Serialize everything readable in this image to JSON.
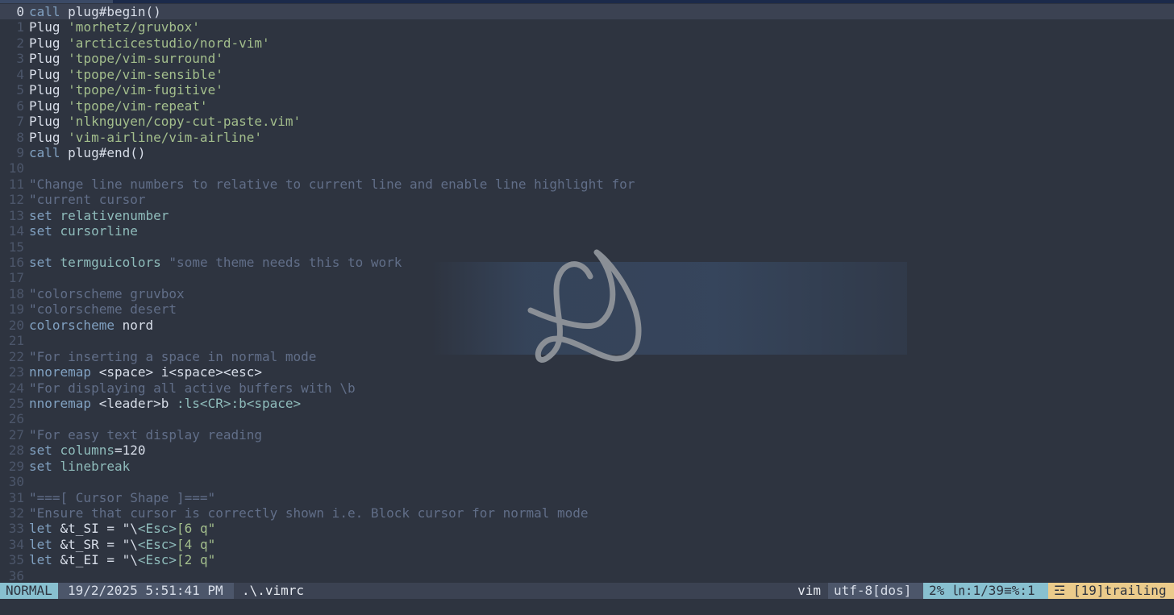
{
  "editor": {
    "lines": [
      {
        "n": "0",
        "current": true,
        "tokens": [
          [
            "kw",
            "call"
          ],
          [
            "plain",
            " plug#begin()"
          ]
        ]
      },
      {
        "n": "1",
        "tokens": [
          [
            "plain",
            "Plug "
          ],
          [
            "str",
            "'morhetz/gruvbox'"
          ]
        ]
      },
      {
        "n": "2",
        "tokens": [
          [
            "plain",
            "Plug "
          ],
          [
            "str",
            "'arcticicestudio/nord-vim'"
          ]
        ]
      },
      {
        "n": "3",
        "tokens": [
          [
            "plain",
            "Plug "
          ],
          [
            "str",
            "'tpope/vim-surround'"
          ]
        ]
      },
      {
        "n": "4",
        "tokens": [
          [
            "plain",
            "Plug "
          ],
          [
            "str",
            "'tpope/vim-sensible'"
          ]
        ]
      },
      {
        "n": "5",
        "tokens": [
          [
            "plain",
            "Plug "
          ],
          [
            "str",
            "'tpope/vim-fugitive'"
          ]
        ]
      },
      {
        "n": "6",
        "tokens": [
          [
            "plain",
            "Plug "
          ],
          [
            "str",
            "'tpope/vim-repeat'"
          ]
        ]
      },
      {
        "n": "7",
        "tokens": [
          [
            "plain",
            "Plug "
          ],
          [
            "str",
            "'nlknguyen/copy-cut-paste.vim'"
          ]
        ]
      },
      {
        "n": "8",
        "tokens": [
          [
            "plain",
            "Plug "
          ],
          [
            "str",
            "'vim-airline/vim-airline'"
          ]
        ]
      },
      {
        "n": "9",
        "tokens": [
          [
            "kw",
            "call"
          ],
          [
            "plain",
            " plug#end()"
          ]
        ]
      },
      {
        "n": "10",
        "tokens": []
      },
      {
        "n": "11",
        "tokens": [
          [
            "cmt",
            "\"Change line numbers to relative to current line and enable line highlight for"
          ]
        ]
      },
      {
        "n": "12",
        "tokens": [
          [
            "cmt",
            "\"current cursor"
          ]
        ]
      },
      {
        "n": "13",
        "tokens": [
          [
            "kw",
            "set"
          ],
          [
            "plain",
            " "
          ],
          [
            "id",
            "relativenumber"
          ]
        ]
      },
      {
        "n": "14",
        "tokens": [
          [
            "kw",
            "set"
          ],
          [
            "plain",
            " "
          ],
          [
            "id",
            "cursorline"
          ]
        ]
      },
      {
        "n": "15",
        "tokens": []
      },
      {
        "n": "16",
        "tokens": [
          [
            "kw",
            "set"
          ],
          [
            "plain",
            " "
          ],
          [
            "id",
            "termguicolors"
          ],
          [
            "plain",
            " "
          ],
          [
            "cmt",
            "\"some theme needs this to work"
          ]
        ]
      },
      {
        "n": "17",
        "tokens": []
      },
      {
        "n": "18",
        "tokens": [
          [
            "cmt",
            "\"colorscheme gruvbox"
          ]
        ]
      },
      {
        "n": "19",
        "tokens": [
          [
            "cmt",
            "\"colorscheme desert"
          ]
        ]
      },
      {
        "n": "20",
        "tokens": [
          [
            "kw",
            "colorscheme"
          ],
          [
            "plain",
            " nord"
          ]
        ]
      },
      {
        "n": "21",
        "tokens": []
      },
      {
        "n": "22",
        "tokens": [
          [
            "cmt",
            "\"For inserting a space in normal mode"
          ]
        ]
      },
      {
        "n": "23",
        "tokens": [
          [
            "kw",
            "nnoremap"
          ],
          [
            "plain",
            " <space> i<space><esc>"
          ]
        ]
      },
      {
        "n": "24",
        "tokens": [
          [
            "cmt",
            "\"For displaying all active buffers with \\b"
          ]
        ]
      },
      {
        "n": "25",
        "tokens": [
          [
            "kw",
            "nnoremap"
          ],
          [
            "plain",
            " <leader>b "
          ],
          [
            "id",
            ":ls<CR>:b<space>"
          ]
        ]
      },
      {
        "n": "26",
        "tokens": []
      },
      {
        "n": "27",
        "tokens": [
          [
            "cmt",
            "\"For easy text display reading"
          ]
        ]
      },
      {
        "n": "28",
        "tokens": [
          [
            "kw",
            "set"
          ],
          [
            "plain",
            " "
          ],
          [
            "id",
            "columns"
          ],
          [
            "plain",
            "=120"
          ]
        ]
      },
      {
        "n": "29",
        "tokens": [
          [
            "kw",
            "set"
          ],
          [
            "plain",
            " "
          ],
          [
            "id",
            "linebreak"
          ]
        ]
      },
      {
        "n": "30",
        "tokens": []
      },
      {
        "n": "31",
        "tokens": [
          [
            "cmt",
            "\"===[ Cursor Shape ]===\""
          ]
        ]
      },
      {
        "n": "32",
        "tokens": [
          [
            "cmt",
            "\"Ensure that cursor is correctly shown i.e. Block cursor for normal mode"
          ]
        ]
      },
      {
        "n": "33",
        "tokens": [
          [
            "kw",
            "let"
          ],
          [
            "plain",
            " &t_SI = \"\\"
          ],
          [
            "id",
            "<Esc>"
          ],
          [
            "str",
            "[6 q\""
          ]
        ]
      },
      {
        "n": "34",
        "tokens": [
          [
            "kw",
            "let"
          ],
          [
            "plain",
            " &t_SR = \"\\"
          ],
          [
            "id",
            "<Esc>"
          ],
          [
            "str",
            "[4 q\""
          ]
        ]
      },
      {
        "n": "35",
        "tokens": [
          [
            "kw",
            "let"
          ],
          [
            "plain",
            " &t_EI = \"\\"
          ],
          [
            "id",
            "<Esc>"
          ],
          [
            "str",
            "[2 q\""
          ]
        ]
      },
      {
        "n": "36",
        "tokens": []
      }
    ]
  },
  "statusline": {
    "mode": "NORMAL",
    "datetime": "19/2/2025 5:51:41 PM",
    "filename": ".\\.vimrc",
    "filetype": "vim",
    "encoding": "utf-8[dos]",
    "position": "2%  ㏑:1/39≡%:1",
    "warning": "☲ [19]trailing"
  },
  "colors": {
    "background": "#2e3440",
    "accent": "#88c0d0",
    "warning": "#ebcb8b",
    "string": "#a3be8c",
    "keyword": "#81a1c1",
    "comment": "#616e88"
  },
  "watermark": {
    "icon": "signature-logo-icon"
  }
}
